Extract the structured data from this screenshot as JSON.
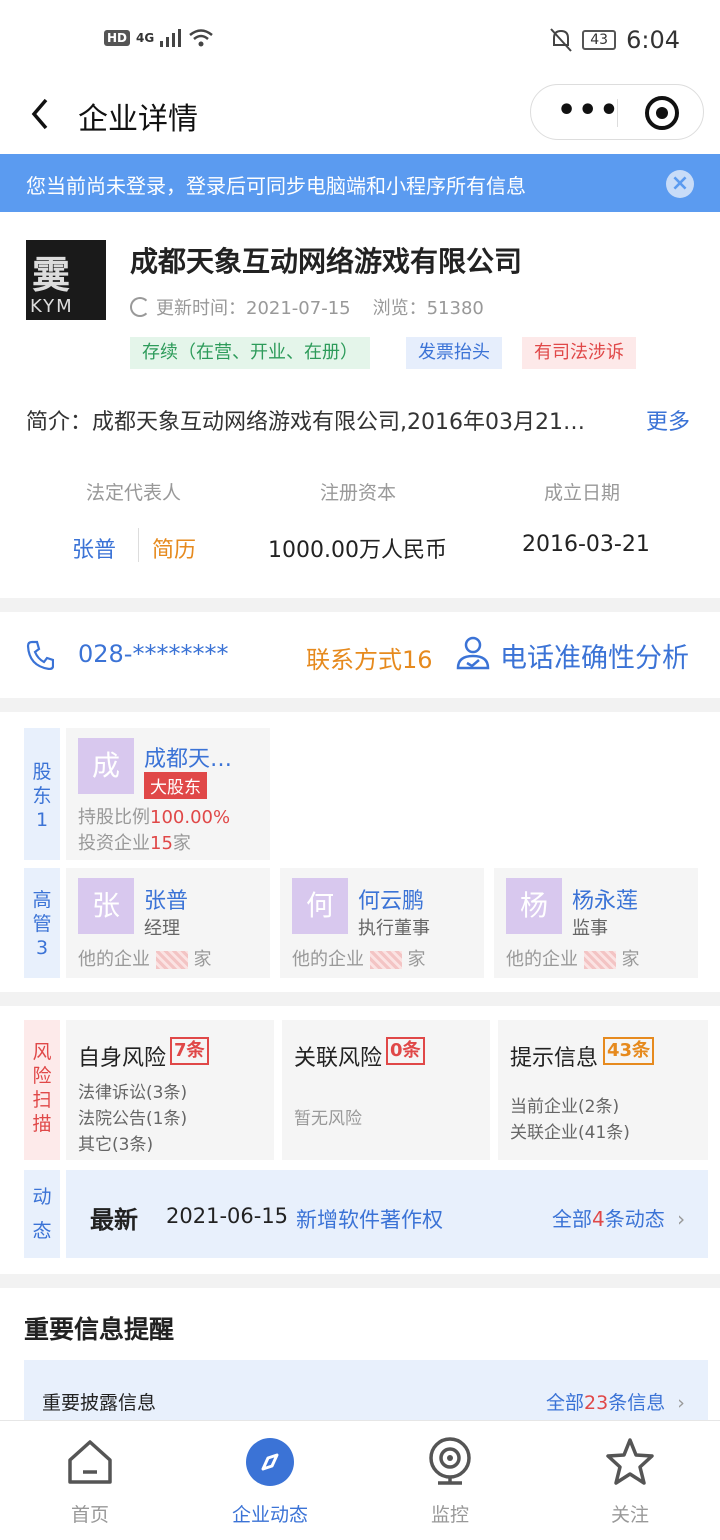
{
  "status": {
    "hd": "HD",
    "network": "4G",
    "battery": "43",
    "time": "6:04"
  },
  "nav": {
    "title": "企业详情",
    "menu": "•••"
  },
  "banner": {
    "text": "您当前尚未登录，登录后可同步电脑端和小程序所有信息"
  },
  "company": {
    "logo_big": "霙",
    "logo_small": "KYM",
    "name": "成都天象互动网络游戏有限公司",
    "update": "更新时间：2021-07-15",
    "views": "浏览：51380",
    "tags": [
      "存续（在营、开业、在册）",
      "发票抬头",
      "有司法涉诉"
    ],
    "intro": "简介：成都天象互动网络游戏有限公司,2016年03月21…",
    "more": "更多",
    "headers": [
      "法定代表人",
      "注册资本",
      "成立日期"
    ],
    "legal_rep": "张普",
    "resume": "简历",
    "capital": "1000.00万人民币",
    "founded": "2016-03-21"
  },
  "contact": {
    "phone": "028-********",
    "contacts": "联系方式16",
    "analyze": "电话准确性分析"
  },
  "holders": {
    "label": "股东1",
    "holder": {
      "avatar": "成",
      "name": "成都天…",
      "tag": "大股东",
      "ratio_label": "持股比例",
      "ratio": "100.00%",
      "invest_label": "投资企业",
      "invest_count": "15",
      "invest_unit": "家"
    }
  },
  "executives": {
    "label": "高管3",
    "sub_prefix": "他的企业",
    "sub_suffix": "家",
    "items": [
      {
        "avatar": "张",
        "name": "张普",
        "role": "经理"
      },
      {
        "avatar": "何",
        "name": "何云鹏",
        "role": "执行董事"
      },
      {
        "avatar": "杨",
        "name": "杨永莲",
        "role": "监事"
      }
    ]
  },
  "risk": {
    "label": "风险扫描",
    "cards": [
      {
        "title": "自身风险",
        "badge": "7条",
        "lines": [
          "法律诉讼(3条)",
          "法院公告(1条)",
          "其它(3条)"
        ]
      },
      {
        "title": "关联风险",
        "badge": "0条",
        "lines": [
          "暂无风险"
        ]
      },
      {
        "title": "提示信息",
        "badge": "43条",
        "lines": [
          "当前企业(2条)",
          "关联企业(41条)"
        ]
      }
    ]
  },
  "news": {
    "label": "动态",
    "latest": "最新",
    "date": "2021-06-15",
    "text": "新增软件著作权",
    "all_prefix": "全部",
    "all_count": "4",
    "all_suffix": "条动态"
  },
  "important": {
    "title": "重要信息提醒",
    "label": "重要披露信息",
    "all_prefix": "全部",
    "all_count": "23",
    "all_suffix": "条信息"
  },
  "tabs": [
    {
      "label": "首页",
      "icon": "home-icon"
    },
    {
      "label": "企业动态",
      "icon": "compass-icon"
    },
    {
      "label": "监控",
      "icon": "camera-icon"
    },
    {
      "label": "关注",
      "icon": "star-icon"
    }
  ],
  "colors": {
    "accent": "#3b73d6",
    "orange": "#e68a1e",
    "red": "#e04848",
    "banner": "#5b9bf0"
  }
}
